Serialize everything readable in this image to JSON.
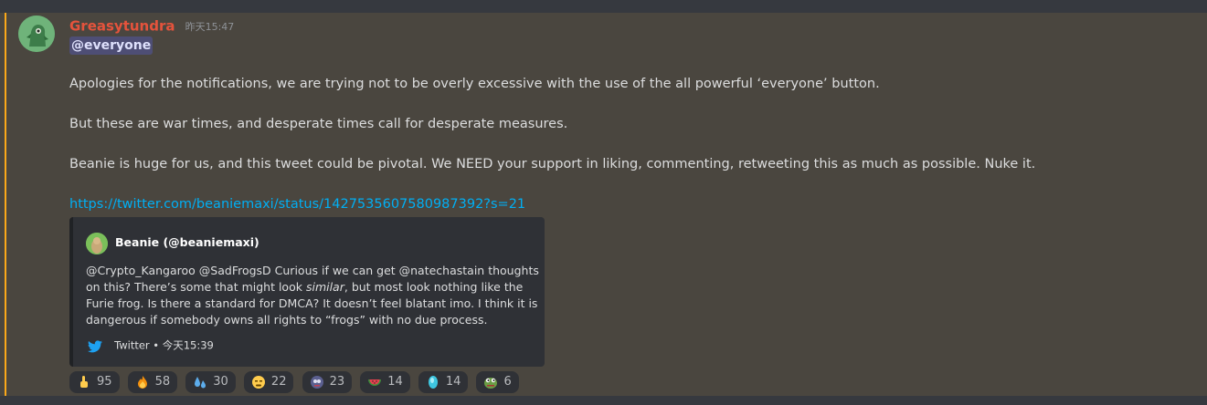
{
  "message": {
    "author": "Greasytundra",
    "timestamp": "昨天15:47",
    "mention": "@everyone",
    "paragraphs": [
      "Apologies for the notifications, we are trying not to be overly excessive with the use of the all powerful ‘everyone’ button.",
      "But these are war times, and desperate times call for desperate measures.",
      "Beanie is huge for us, and this tweet could be pivotal. We NEED your support in liking, commenting, retweeting this as much as possible. Nuke it."
    ],
    "link": "https://twitter.com/beaniemaxi/status/1427535607580987392?s=21"
  },
  "embed": {
    "author": "Beanie (@beaniemaxi)",
    "desc_before": "@Crypto_Kangaroo @SadFrogsD Curious if we can get @natechastain thoughts on this? There’s some that might look ",
    "desc_italic": "similar",
    "desc_after": ", but most look nothing like the Furie frog. Is there a standard for DMCA? It doesn’t feel blatant imo. I think it is dangerous if somebody owns all rights to “frogs” with no due process.",
    "footer": "Twitter • 今天15:39"
  },
  "reactions": [
    {
      "emoji": "point-up-emoji",
      "count": "95"
    },
    {
      "emoji": "fire-emoji",
      "count": "58"
    },
    {
      "emoji": "sweat-drops-emoji",
      "count": "30"
    },
    {
      "emoji": "angry-face-emoji",
      "count": "22"
    },
    {
      "emoji": "custom-frog-emoji",
      "count": "23"
    },
    {
      "emoji": "watermelon-emoji",
      "count": "14"
    },
    {
      "emoji": "blue-gem-emoji",
      "count": "14"
    },
    {
      "emoji": "pepe-frog-emoji",
      "count": "6"
    }
  ],
  "colors": {
    "author": "#e5533c",
    "link": "#00aff4",
    "accent": "#faa81a",
    "message_bg": "#4a463f"
  }
}
